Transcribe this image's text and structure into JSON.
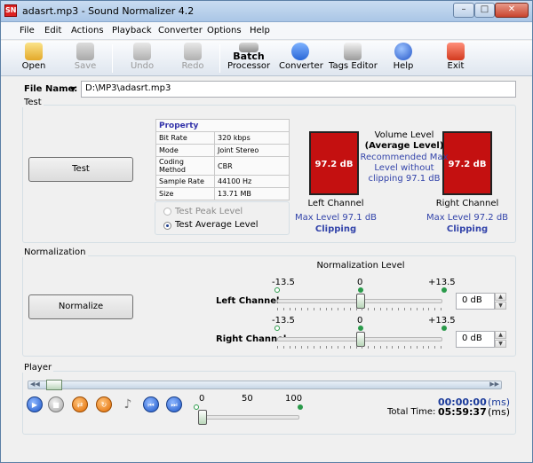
{
  "window": {
    "title": "adasrt.mp3 - Sound Normalizer 4.2",
    "app_icon_text": "SN",
    "min_glyph": "–",
    "max_glyph": "□",
    "close_glyph": "✕"
  },
  "menu": [
    "File",
    "Edit",
    "Actions",
    "Playback",
    "Converter",
    "Options",
    "Help"
  ],
  "toolbar": {
    "open": "Open",
    "save": "Save",
    "undo": "Undo",
    "redo": "Redo",
    "batch_line1": "Batch",
    "batch_line2": "Processor",
    "converter": "Converter",
    "tags": "Tags Editor",
    "help": "Help",
    "exit": "Exit"
  },
  "file": {
    "label": "File Name:",
    "value": "D:\\MP3\\adasrt.mp3",
    "dropdown_glyph": "▼"
  },
  "test": {
    "group": "Test",
    "button": "Test",
    "property_header": "Property",
    "properties": [
      {
        "k": "Bit Rate",
        "v": "320 kbps"
      },
      {
        "k": "Mode",
        "v": "Joint Stereo"
      },
      {
        "k": "Coding Method",
        "v": "CBR"
      },
      {
        "k": "Sample Rate",
        "v": "44100 Hz"
      },
      {
        "k": "Size",
        "v": "13.71 MB"
      }
    ],
    "radio_peak": "Test Peak Level",
    "radio_avg": "Test Average Level",
    "left_meter": "97.2 dB",
    "right_meter": "97.2 dB",
    "volume_title": "Volume Level",
    "volume_mode": "(Average Level)",
    "recommended": [
      "Recommended Max",
      "Level without",
      "clipping 97.1 dB"
    ],
    "left_label": "Left Channel",
    "right_label": "Right Channel",
    "left_max": "Max Level 97.1 dB",
    "right_max": "Max Level 97.2 dB",
    "left_clip": "Clipping",
    "right_clip": "Clipping"
  },
  "normalization": {
    "group": "Normalization",
    "button": "Normalize",
    "level_title": "Normalization Level",
    "left": {
      "label": "Left Channel",
      "min": "-13.5",
      "mid": "0",
      "max": "+13.5",
      "value": "0 dB",
      "level": 0
    },
    "right": {
      "label": "Right Channel",
      "min": "-13.5",
      "mid": "0",
      "max": "+13.5",
      "value": "0 dB",
      "level": 0
    }
  },
  "player": {
    "group": "Player",
    "seek_left": "◀◀",
    "seek_right": "▶▶",
    "buttons": [
      {
        "name": "play",
        "glyph": "▶"
      },
      {
        "name": "stop",
        "glyph": "■"
      },
      {
        "name": "shuffle",
        "glyph": "⇄"
      },
      {
        "name": "repeat",
        "glyph": "↻"
      },
      {
        "name": "volume",
        "glyph": "♪"
      },
      {
        "name": "prev",
        "glyph": "⏮"
      },
      {
        "name": "next",
        "glyph": "⏭"
      }
    ],
    "volume_scale": {
      "min": "0",
      "mid": "50",
      "max": "100",
      "level": 0
    },
    "position_time": "00:00:00",
    "position_unit": "(ms)",
    "total_label": "Total Time:",
    "total_time": "05:59:37",
    "total_unit": "(ms)"
  },
  "colors": {
    "meter": "#c41010",
    "accent_blue": "#3344aa",
    "time_blue": "#1a3a9a"
  }
}
